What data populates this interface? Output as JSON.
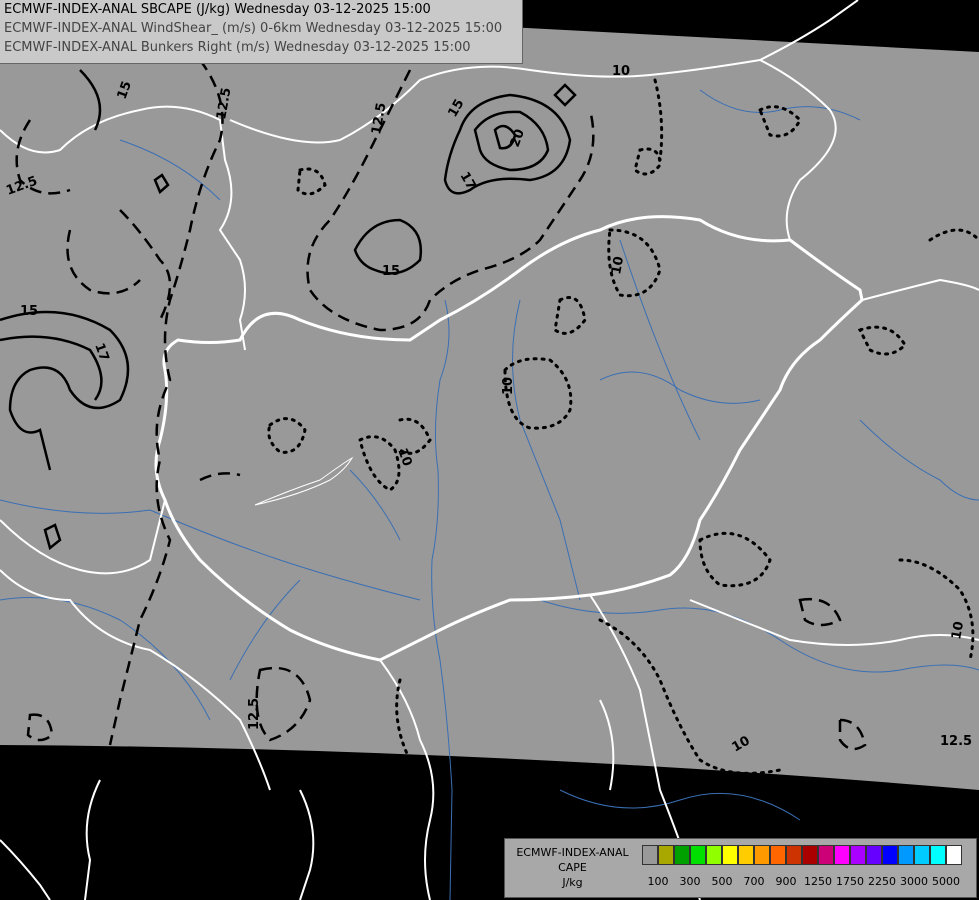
{
  "header": {
    "line1": "ECMWF-INDEX-ANAL SBCAPE (J/kg) Wednesday 03-12-2025 15:00",
    "line2": "ECMWF-INDEX-ANAL WindShear_ (m/s) 0-6km Wednesday 03-12-2025 15:00",
    "line3": "ECMWF-INDEX-ANAL Bunkers Right (m/s) Wednesday 03-12-2025 15:00"
  },
  "map": {
    "colors": {
      "background": "#000000",
      "domain": "#999999",
      "borders": "#ffffff",
      "rivers": "#3a6fb4",
      "contours": "#000000"
    },
    "contour_labels": [
      "15",
      "12.5",
      "12.5",
      "12.5",
      "15",
      "17",
      "20",
      "17",
      "10",
      "15",
      "12.5",
      "10",
      "10",
      "10",
      "10",
      "10",
      "12.5",
      "15"
    ]
  },
  "legend": {
    "title_line1": "ECMWF-INDEX-ANAL",
    "title_line2": "CAPE",
    "title_line3": "J/kg",
    "colors": [
      "#999999",
      "#a8a800",
      "#00a000",
      "#00e000",
      "#90ff00",
      "#ffff00",
      "#ffcc00",
      "#ff9900",
      "#ff6600",
      "#cc3300",
      "#aa0000",
      "#cc0077",
      "#ff00ff",
      "#aa00ff",
      "#6600ff",
      "#0000ff",
      "#0099ff",
      "#00ccff",
      "#00ffff",
      "#ffffff"
    ],
    "ticks": [
      "100",
      "300",
      "500",
      "700",
      "900",
      "1250",
      "1750",
      "2250",
      "3000",
      "5000"
    ]
  }
}
